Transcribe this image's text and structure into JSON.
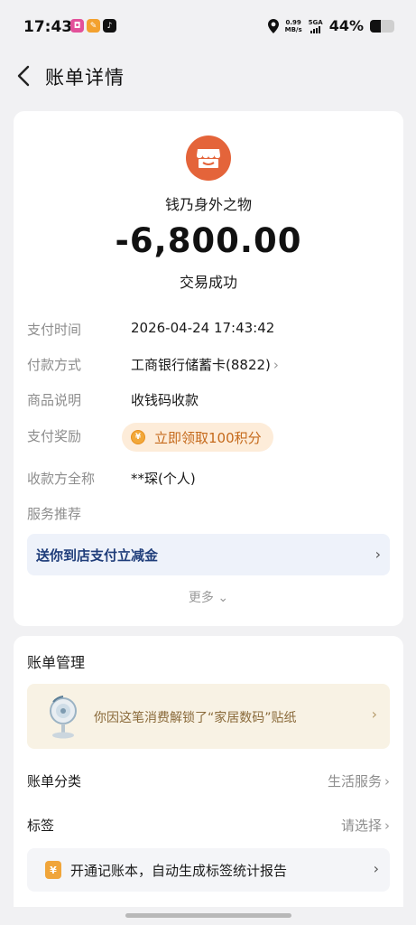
{
  "status_bar": {
    "time": "17:43",
    "net_speed_value": "0.99",
    "net_speed_unit": "MB/s",
    "signal_label": "5GA",
    "battery_percent": "44%",
    "battery_level": 0.44
  },
  "header": {
    "title": "账单详情"
  },
  "transaction": {
    "merchant": "钱乃身外之物",
    "amount": "-6,800.00",
    "status": "交易成功",
    "details": [
      {
        "label": "支付时间",
        "value": "2026-04-24 17:43:42"
      },
      {
        "label": "付款方式",
        "value": "工商银行储蓄卡(8822)"
      },
      {
        "label": "商品说明",
        "value": "收钱码收款"
      },
      {
        "label": "支付奖励",
        "value": ""
      },
      {
        "label": "收款方全称",
        "value": "**琛(个人)"
      },
      {
        "label": "服务推荐",
        "value": ""
      }
    ],
    "reward_text": "立即领取100积分",
    "promo_text": "送你到店支付立减金",
    "more_label": "更多"
  },
  "management": {
    "title": "账单管理",
    "sticker_text": "你因这笔消费解锁了“家居数码”贴纸",
    "category_label": "账单分类",
    "category_value": "生活服务",
    "tag_label": "标签",
    "tag_value": "请选择",
    "ledger_text": "开通记账本，自动生成标签统计报告"
  },
  "colors": {
    "merchant_icon": "#e4643a",
    "reward_bg": "#fdecd9",
    "reward_text": "#c5691b",
    "promo_bg": "#eef2fa",
    "sticker_bg": "#f8f2e4"
  }
}
